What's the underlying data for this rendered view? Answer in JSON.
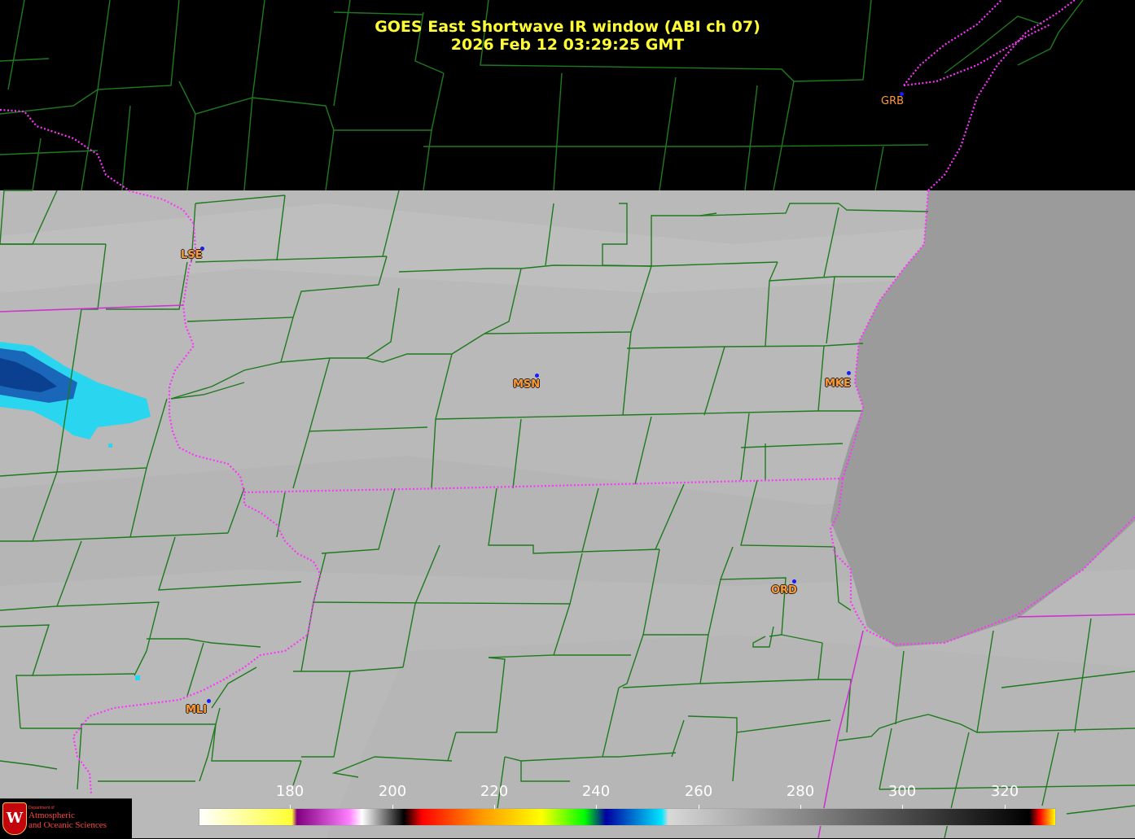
{
  "title": {
    "line1": "GOES East Shortwave IR window (ABI ch 07)",
    "line2": "2026 Feb 12  03:29:25 GMT"
  },
  "stations": [
    {
      "id": "GRB",
      "label": "GRB"
    },
    {
      "id": "LSE",
      "label": "LSE"
    },
    {
      "id": "MSN",
      "label": "MSN"
    },
    {
      "id": "MKE",
      "label": "MKE"
    },
    {
      "id": "ORD",
      "label": "ORD"
    },
    {
      "id": "MLI",
      "label": "MLI"
    }
  ],
  "colorbar": {
    "ticks": [
      "180",
      "200",
      "220",
      "240",
      "260",
      "280",
      "300",
      "320"
    ],
    "colors": [
      "#ffffff",
      "#ffff33",
      "#800080",
      "#ff80ff",
      "#ffffff",
      "#000000",
      "#ff0000",
      "#ff9900",
      "#ffff00",
      "#00ff00",
      "#0000a0",
      "#00e5ff",
      "#d8d8d8",
      "#000000",
      "#ff0000",
      "#ffff00"
    ]
  },
  "logo": {
    "dept": "Department of",
    "name_line1": "Atmospheric",
    "name_line2": "and Oceanic Sciences"
  },
  "colors": {
    "county_lines": "#1f7a1f",
    "state_lines": "#ff33ff",
    "land": "#b8b8b8",
    "lake": "#9a9a9a",
    "title": "#ffff33",
    "station_label": "#ff9933"
  }
}
